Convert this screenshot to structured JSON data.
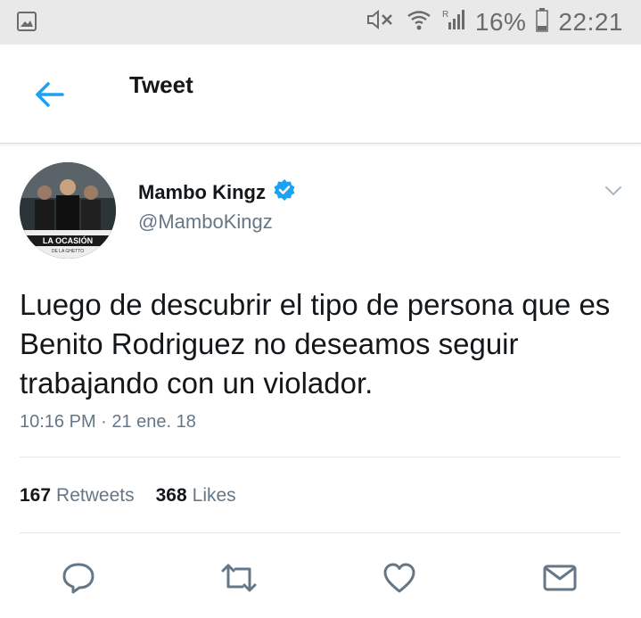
{
  "statusbar": {
    "battery_percent": "16%",
    "time": "22:21",
    "signal_label": "R",
    "icons": [
      "gallery-icon",
      "mute-icon",
      "wifi-icon",
      "signal-icon",
      "battery-icon"
    ]
  },
  "header": {
    "title": "Tweet",
    "back_icon": "arrow-left-icon"
  },
  "tweet": {
    "author": {
      "display_name": "Mambo Kingz",
      "handle": "@MamboKingz",
      "verified": true,
      "avatar_caption": "LA OCASIÓN",
      "avatar_subcaption": "DE LA GHETTO"
    },
    "text": "Luego de descubrir el tipo de persona que es Benito Rodriguez no deseamos seguir trabajando con un violador.",
    "timestamp": "10:16 PM · 21 ene. 18",
    "stats": {
      "retweets_count": "167",
      "retweets_label": "Retweets",
      "likes_count": "368",
      "likes_label": "Likes"
    }
  },
  "actions": [
    "reply-icon",
    "retweet-icon",
    "like-icon",
    "direct-message-icon"
  ],
  "colors": {
    "accent": "#1da1f2",
    "icon_gray": "#657786",
    "text": "#14171a",
    "statusbar_bg": "#e9e9e9"
  }
}
